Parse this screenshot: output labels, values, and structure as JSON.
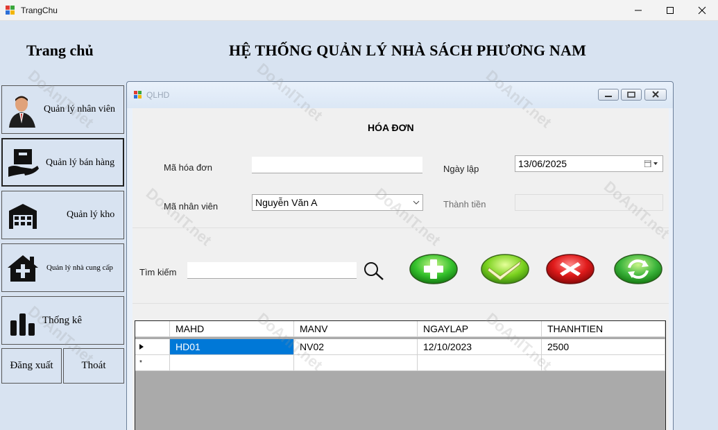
{
  "window": {
    "title": "TrangChu"
  },
  "header": {
    "home_title": "Trang chủ",
    "system_title": "HỆ THỐNG QUẢN LÝ NHÀ SÁCH PHƯƠNG NAM"
  },
  "menu": {
    "items": [
      {
        "label": "Quản lý nhân viên",
        "icon": "employee-icon"
      },
      {
        "label": "Quản lý bán hàng",
        "icon": "sales-icon"
      },
      {
        "label": "Quản lý kho",
        "icon": "warehouse-icon"
      },
      {
        "label": "Quản lý nhà cung cấp",
        "icon": "supplier-house-icon"
      },
      {
        "label": "Thống kê",
        "icon": "bar-chart-icon"
      }
    ],
    "logout": "Đăng xuất",
    "exit": "Thoát"
  },
  "child": {
    "title": "QLHD",
    "form_title": "HÓA ĐƠN",
    "labels": {
      "invoice_id": "Mã hóa đơn",
      "date": "Ngày lập",
      "employee_id": "Mã nhân viên",
      "total": "Thành tiền",
      "search": "Tìm kiếm"
    },
    "values": {
      "invoice_id": "",
      "date": "13/06/2025",
      "employee": "Nguyễn Văn A",
      "total": "",
      "search": ""
    }
  },
  "grid": {
    "columns": [
      "MAHD",
      "MANV",
      "NGAYLAP",
      "THANHTIEN"
    ],
    "rows": [
      [
        "HD01",
        "NV02",
        "12/10/2023",
        "2500"
      ]
    ],
    "new_row_marker": "*"
  },
  "watermark": "DoAnIT.net",
  "colors": {
    "background": "#d8e3f1",
    "selected_cell": "#0078d7",
    "add_button": "#2fbf2f",
    "save_button": "#7dd11e",
    "delete_button": "#e01b1b",
    "refresh_button": "#3bb43b"
  }
}
